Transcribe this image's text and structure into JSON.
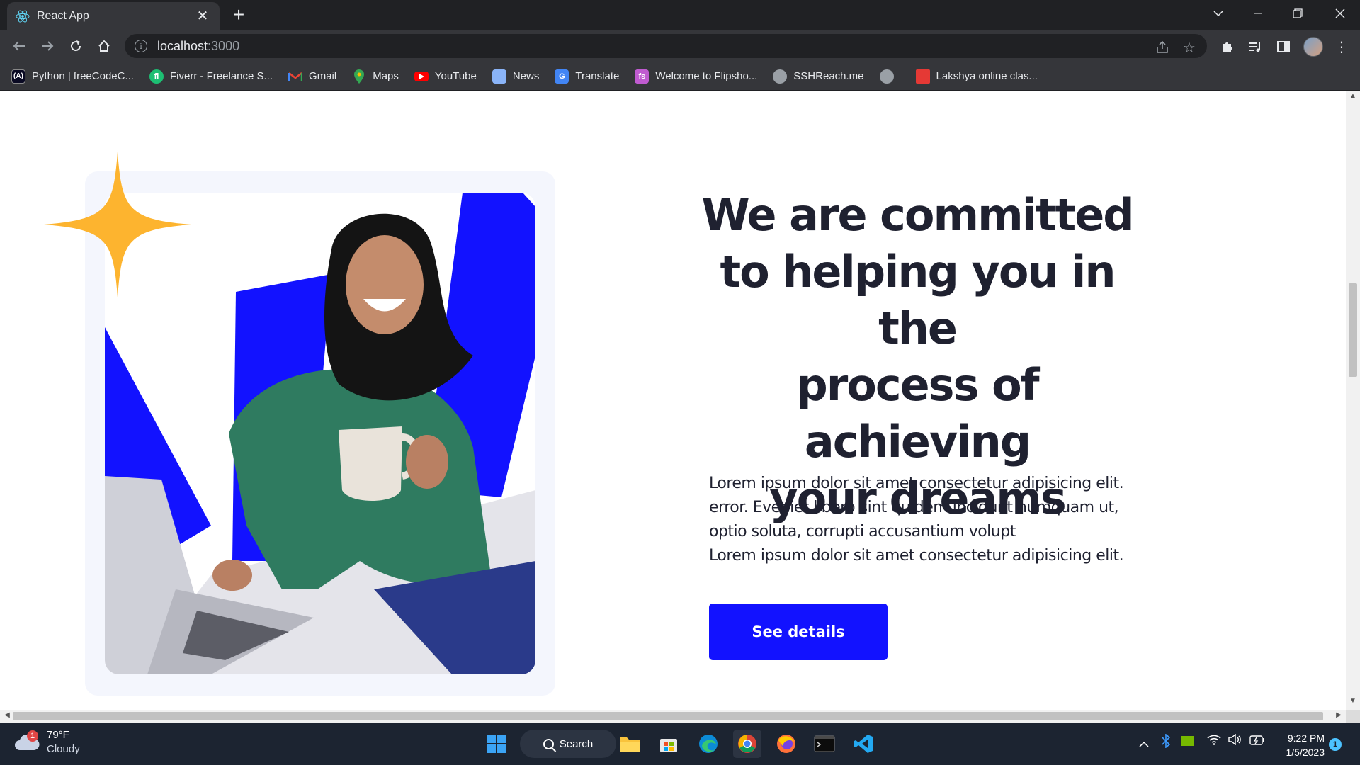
{
  "browser": {
    "tab_title": "React App",
    "url_host": "localhost",
    "url_port": ":3000",
    "bookmarks": [
      {
        "label": "Python | freeCodeC...",
        "icon": "freecodecamp-icon"
      },
      {
        "label": "Fiverr - Freelance S...",
        "icon": "fiverr-icon"
      },
      {
        "label": "Gmail",
        "icon": "gmail-icon"
      },
      {
        "label": "Maps",
        "icon": "maps-icon"
      },
      {
        "label": "YouTube",
        "icon": "youtube-icon"
      },
      {
        "label": "News",
        "icon": "news-icon"
      },
      {
        "label": "Translate",
        "icon": "translate-icon"
      },
      {
        "label": "Welcome to Flipsho...",
        "icon": "flipshop-icon"
      },
      {
        "label": "SSHReach.me",
        "icon": "globe-icon"
      },
      {
        "label": "",
        "icon": "globe-icon"
      },
      {
        "label": "Lakshya online clas...",
        "icon": "lakshya-icon"
      }
    ]
  },
  "hero": {
    "heading_lines": [
      "We are committed",
      "to helping you in the",
      "process of achieving",
      "your dreams"
    ],
    "paragraph_lines": [
      "Lorem ipsum dolor sit amet consectetur adipisicing elit.",
      "error. Eveniet libero sint quidem incidunt numquam ut,",
      "optio soluta, corrupti accusantium volupt",
      "Lorem ipsum dolor sit amet consectetur adipisicing elit."
    ],
    "cta_label": "See details"
  },
  "colors": {
    "accent": "#1212ff",
    "star": "#fdb42f",
    "heading": "#1f2130",
    "card_bg": "#f4f6fd"
  },
  "taskbar": {
    "weather_temp": "79°F",
    "weather_desc": "Cloudy",
    "weather_badge": "1",
    "search_label": "Search",
    "time": "9:22 PM",
    "date": "1/5/2023",
    "notification_count": "1"
  }
}
